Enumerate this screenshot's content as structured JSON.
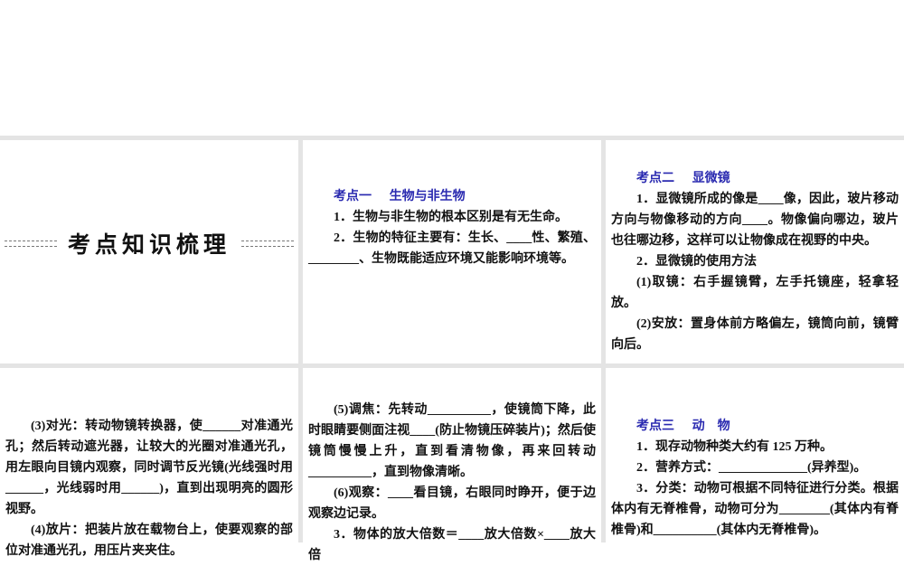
{
  "section_title": "考点知识梳理",
  "panel_k1": {
    "heading_num": "考点一",
    "heading_title": "生物与非生物",
    "paragraphs": [
      "1．生物与非生物的根本区别是有无生命。",
      "2．生物的特征主要有：生长、____性、繁殖、________、生物既能适应环境又能影响环境等。"
    ]
  },
  "panel_k2": {
    "heading_num": "考点二",
    "heading_title": "显微镜",
    "paragraphs": [
      "1．显微镜所成的像是____像，因此，玻片移动方向与物像移动的方向____。物像偏向哪边，玻片也往哪边移，这样可以让物像成在视野的中央。",
      "2．显微镜的使用方法",
      "(1)取镜：右手握镜臂，左手托镜座，轻拿轻放。",
      "(2)安放：置身体前方略偏左，镜筒向前，镜臂向后。"
    ]
  },
  "panel_use1": {
    "paragraphs": [
      "(3)对光：转动物镜转换器，使______对准通光孔；然后转动遮光器，让较大的光圈对准通光孔，用左眼向目镜内观察，同时调节反光镜(光线强时用______，光线弱时用______)，直到出现明亮的圆形视野。",
      "(4)放片：把装片放在载物台上，使要观察的部位对准通光孔，用压片夹夹住。"
    ]
  },
  "panel_use2": {
    "paragraphs": [
      "(5)调焦：先转动__________，使镜筒下降，此时眼睛要侧面注视____(防止物镜压碎装片)；然后使镜筒慢慢上升，直到看清物像，再来回转动__________，直到物像清晰。",
      "(6)观察：____看目镜，右眼同时睁开，便于边观察边记录。",
      "3．物体的放大倍数＝____放大倍数×____放大倍"
    ]
  },
  "panel_k3": {
    "heading_num": "考点三",
    "heading_title": "动　物",
    "paragraphs": [
      "1．现存动物种类大约有 125 万种。",
      "2．营养方式：______________(异养型)。",
      "3．分类：动物可根据不同特征进行分类。根据体内有无脊椎骨，动物可分为________(其体内有脊椎骨)和__________(其体内无脊椎骨)。"
    ]
  }
}
